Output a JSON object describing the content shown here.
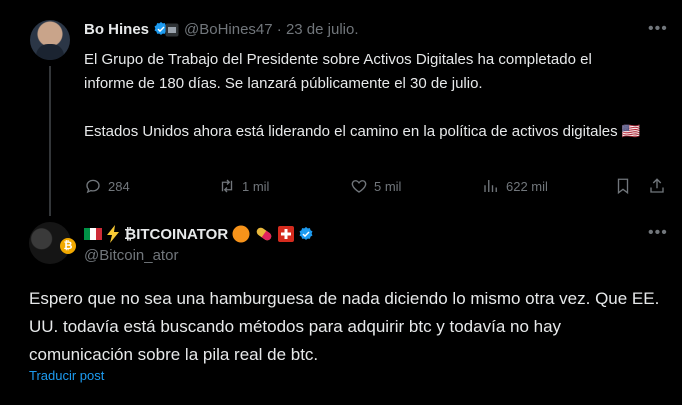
{
  "colors": {
    "background": "#000000",
    "text": "#e7e9ea",
    "muted": "#71767b",
    "link": "#1d9bf0",
    "verified": "#1d9bf0"
  },
  "post": {
    "author_name": "Bo Hines",
    "handle": "@BoHines47",
    "date": "23 de julio.",
    "paragraph1": "El Grupo de Trabajo del Presidente sobre Activos Digitales ha completado el informe de 180 días. Se lanzará públicamente el 30 de julio.",
    "paragraph2": "Estados Unidos ahora está liderando el camino en la política de activos digitales 🇺🇸",
    "actions": {
      "replies": "284",
      "reposts": "1 mil",
      "likes": "5 mil",
      "views": "622 mil"
    },
    "icons": [
      "verified-icon",
      "affiliate-badge-icon",
      "more-icon",
      "reply-icon",
      "repost-icon",
      "like-icon",
      "views-icon",
      "bookmark-icon",
      "share-icon"
    ]
  },
  "reply": {
    "author_name": "₿ITCOINATOR",
    "handle": "@Bitcoin_ator",
    "text": "Espero que no sea una hamburguesa de nada diciendo lo mismo otra vez. Que EE. UU. todavía está buscando métodos para adquirir btc y todavía no hay comunicación sobre la pila real de btc.",
    "translate_label": "Traducir post",
    "coin_letter": "₿",
    "icons": [
      "italy-flag-icon",
      "lightning-icon",
      "orange-circle-icon",
      "pill-icon",
      "swiss-flag-icon",
      "verified-icon"
    ]
  }
}
